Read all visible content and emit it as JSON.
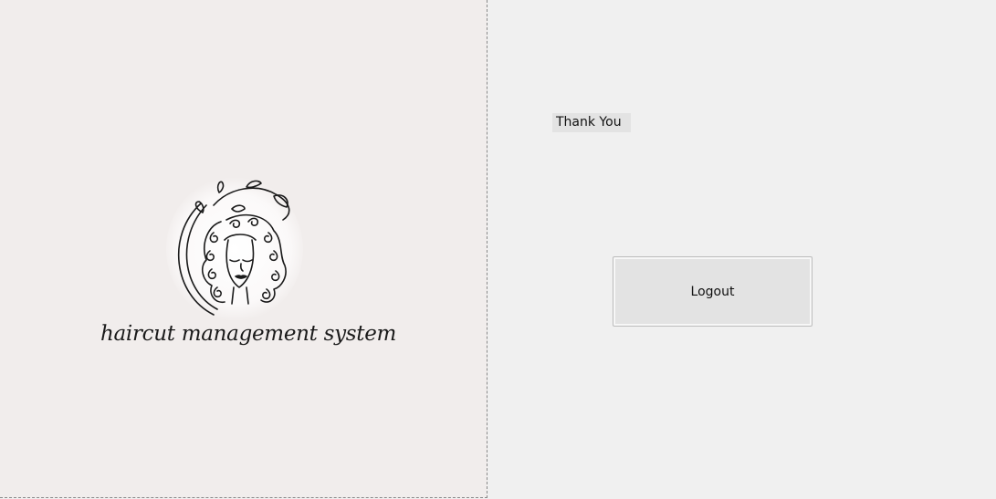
{
  "left_panel": {
    "logo": {
      "icon": "woman-curly-hair-logo-icon",
      "caption": "haircut management system"
    }
  },
  "right_panel": {
    "message": "Thank You",
    "logout_label": "Logout"
  },
  "colors": {
    "left_panel_bg": "#f1edec",
    "window_bg": "#f0f0f0",
    "button_bg": "#e3e3e3"
  }
}
